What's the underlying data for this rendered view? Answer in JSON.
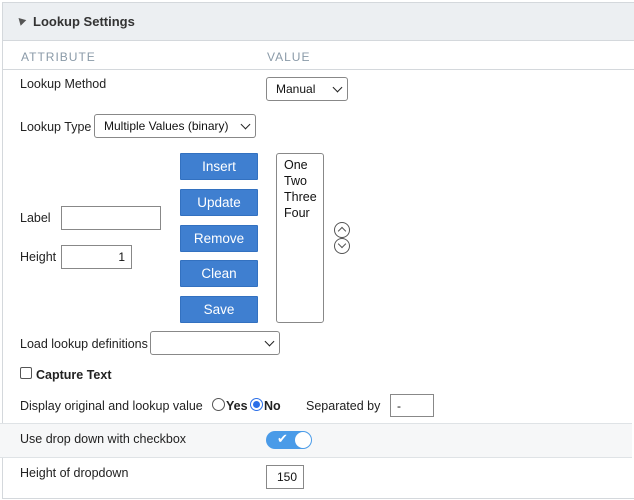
{
  "panel": {
    "title": "Lookup Settings"
  },
  "columns": {
    "attribute": "ATTRIBUTE",
    "value": "VALUE"
  },
  "lookup_method": {
    "label": "Lookup Method",
    "value": "Manual"
  },
  "lookup_type": {
    "label": "Lookup Type",
    "value": "Multiple Values (binary)"
  },
  "buttons": {
    "insert": "Insert",
    "update": "Update",
    "remove": "Remove",
    "clean": "Clean",
    "save": "Save"
  },
  "label_field": {
    "label": "Label",
    "value": ""
  },
  "height_field": {
    "label": "Height",
    "value": "1"
  },
  "list_items": [
    "One",
    "Two",
    "Three",
    "Four"
  ],
  "load_definitions": {
    "label": "Load lookup definitions",
    "value": ""
  },
  "capture_text": {
    "label": "Capture Text",
    "checked": false
  },
  "display_original": {
    "label": "Display original and lookup value",
    "yes": "Yes",
    "no": "No",
    "selected": "No"
  },
  "separated_by": {
    "label": "Separated by",
    "value": "-"
  },
  "dropdown_checkbox": {
    "label": "Use drop down with checkbox",
    "enabled": true
  },
  "dropdown_height": {
    "label": "Height of dropdown",
    "value": "150"
  },
  "colors": {
    "accent": "#3f7fd0",
    "toggle": "#4a9be8",
    "header_bg": "#eceff2",
    "colhead_text": "#8a9aa8"
  },
  "icons": [
    "collapse-arrow-icon",
    "move-up-icon",
    "move-down-icon",
    "chevron-down-icon",
    "check-icon"
  ]
}
